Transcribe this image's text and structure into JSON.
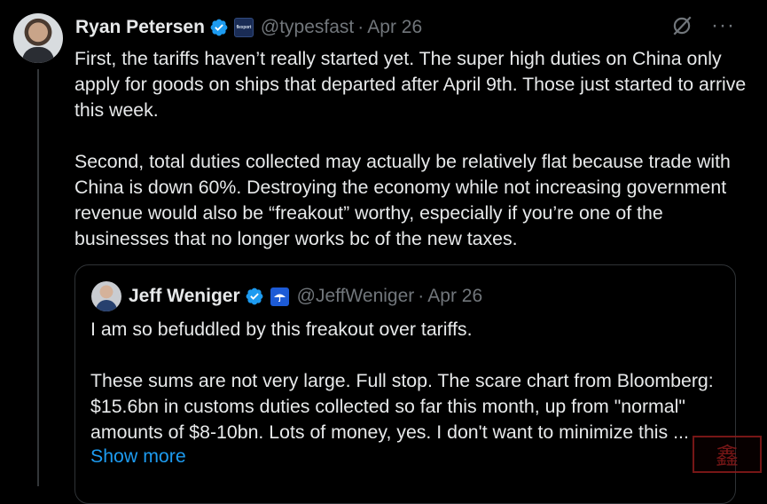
{
  "tweet": {
    "author_name": "Ryan Petersen",
    "handle": "@typesfast",
    "separator": "·",
    "date": "Apr 26",
    "org_badge_text": "flexport",
    "text": "First, the tariffs haven’t really started yet. The super high duties on China only apply for goods on ships that departed after April 9th. Those just started to arrive this week.\n\nSecond, total duties collected may actually be relatively flat because trade with China is down 60%. Destroying the economy while not increasing government revenue would also be “freakout” worthy, especially if you’re one of the businesses that no longer works bc of the new taxes.",
    "more_icon_glyph": "···"
  },
  "quote": {
    "author_name": "Jeff Weniger",
    "handle": "@JeffWeniger",
    "separator": "·",
    "date": "Apr 26",
    "text": "I am so befuddled by this freakout over tariffs.\n\nThese sums are not very large. Full stop. The scare chart from Bloomberg: $15.6bn in customs duties collected so far this month, up from \"normal\" amounts of $8-10bn. Lots of money, yes. I don't want to minimize this ...",
    "show_more": "Show more"
  },
  "watermark_text": "鑫",
  "colors": {
    "background": "#000000",
    "text": "#e7e9ea",
    "muted": "#71767b",
    "link": "#1d9bf0",
    "verified": "#1d9bf0",
    "border": "#2f3336"
  },
  "icons": {
    "verified": "verified-badge-icon",
    "grok": "grok-icon",
    "more": "more-options-icon"
  }
}
